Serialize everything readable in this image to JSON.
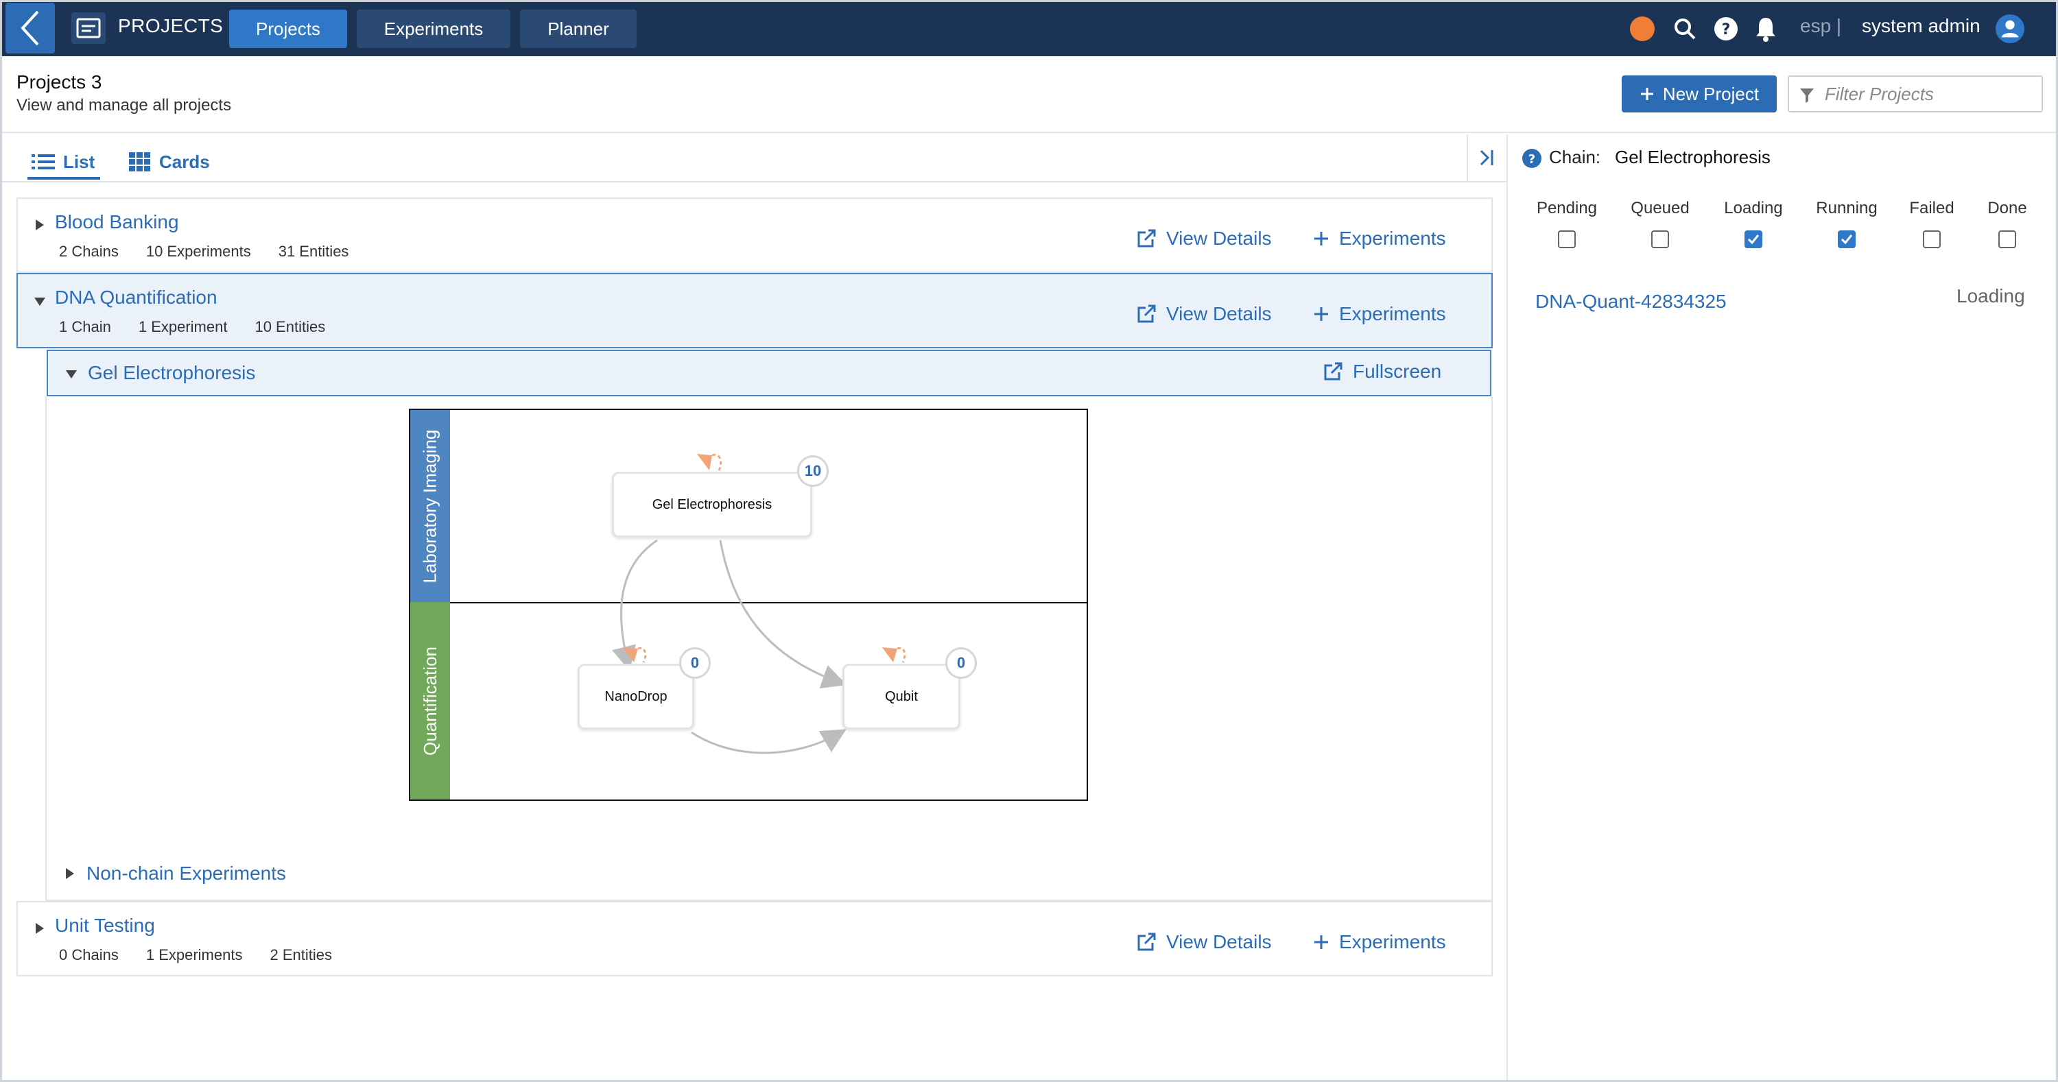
{
  "app": {
    "title": "PROJECTS",
    "nav_tabs": [
      {
        "label": "Projects",
        "active": true
      },
      {
        "label": "Experiments",
        "active": false
      },
      {
        "label": "Planner",
        "active": false
      }
    ],
    "lang": "esp |",
    "user": "system admin",
    "accent_color": "#2b6cb5",
    "topbar_color": "#1b3456",
    "status_dot_color": "#f07f35"
  },
  "header": {
    "title": "Projects 3",
    "subtitle": "View and manage all projects",
    "new_project_label": "New Project",
    "filter_placeholder": "Filter Projects"
  },
  "view_tabs": [
    {
      "label": "List",
      "icon": "list-icon",
      "active": true
    },
    {
      "label": "Cards",
      "icon": "grid-icon",
      "active": false
    }
  ],
  "actions": {
    "view_details": "View Details",
    "experiments": "Experiments",
    "fullscreen": "Fullscreen"
  },
  "projects": [
    {
      "name": "Blood Banking",
      "meta": [
        "2 Chains",
        "10 Experiments",
        "31 Entities"
      ],
      "expanded": false
    },
    {
      "name": "DNA Quantification",
      "meta": [
        "1 Chain",
        "1 Experiment",
        "10 Entities"
      ],
      "expanded": true
    },
    {
      "name": "Unit Testing",
      "meta": [
        "0 Chains",
        "1 Experiments",
        "2 Entities"
      ],
      "expanded": false
    }
  ],
  "chain": {
    "name": "Gel Electrophoresis",
    "lanes": [
      {
        "label": "Laboratory Imaging",
        "color": "#4f86c2"
      },
      {
        "label": "Quantification",
        "color": "#72a85a"
      }
    ],
    "nodes": [
      {
        "label": "Gel Electrophoresis",
        "count": "10"
      },
      {
        "label": "NanoDrop",
        "count": "0"
      },
      {
        "label": "Qubit",
        "count": "0"
      }
    ],
    "non_chain_label": "Non-chain Experiments"
  },
  "right_panel": {
    "chain_label": "Chain:",
    "chain_name": "Gel Electrophoresis",
    "statuses": [
      {
        "label": "Pending",
        "checked": false
      },
      {
        "label": "Queued",
        "checked": false
      },
      {
        "label": "Loading",
        "checked": true
      },
      {
        "label": "Running",
        "checked": true
      },
      {
        "label": "Failed",
        "checked": false
      },
      {
        "label": "Done",
        "checked": false
      }
    ],
    "experiment": {
      "name": "DNA-Quant-42834325",
      "status": "Loading"
    }
  }
}
